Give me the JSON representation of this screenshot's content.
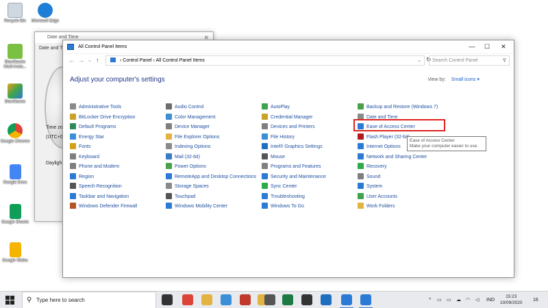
{
  "desktop": {
    "icons": [
      {
        "label": "Recycle Bin",
        "color": "#cfd8e0"
      },
      {
        "label": "Microsoft Edge",
        "color": "#1e7fd6"
      },
      {
        "label": "BlueStacks Multi-Insta...",
        "color": "#7ac143"
      },
      {
        "label": "BlueStacks",
        "color": "#e8a21a"
      },
      {
        "label": "Google Chrome",
        "color": "#db4437"
      },
      {
        "label": "Google Docs",
        "color": "#4285f4"
      },
      {
        "label": "Google Sheets",
        "color": "#0f9d58"
      },
      {
        "label": "Google Slides",
        "color": "#f4b400"
      }
    ]
  },
  "date_time_window": {
    "title": "Date and Time",
    "tab": "Date and Ti",
    "time_zone_label": "Time zo",
    "time_zone_value": "(UTC+07",
    "daylight_label": "Dayligh"
  },
  "control_panel": {
    "title": "All Control Panel Items",
    "address": {
      "crumb_1": "Control Panel",
      "crumb_2": "All Control Panel Items"
    },
    "search_placeholder": "Search Control Panel",
    "heading": "Adjust your computer's settings",
    "view_by_label": "View by:",
    "view_by_value": "Small icons",
    "columns": [
      [
        {
          "label": "Administrative Tools",
          "icon": "tools-icon",
          "color": "#8a8a8a"
        },
        {
          "label": "BitLocker Drive Encryption",
          "icon": "bitlocker-icon",
          "color": "#c9a227"
        },
        {
          "label": "Default Programs",
          "icon": "default-programs-icon",
          "color": "#2e8b57"
        },
        {
          "label": "Energy Star",
          "icon": "energy-star-icon",
          "color": "#3a8fd8"
        },
        {
          "label": "Fonts",
          "icon": "fonts-icon",
          "color": "#d4a017"
        },
        {
          "label": "Keyboard",
          "icon": "keyboard-icon",
          "color": "#7f7f7f"
        },
        {
          "label": "Phone and Modem",
          "icon": "phone-icon",
          "color": "#7f7f7f"
        },
        {
          "label": "Region",
          "icon": "region-icon",
          "color": "#2b7bd6"
        },
        {
          "label": "Speech Recognition",
          "icon": "microphone-icon",
          "color": "#555555"
        },
        {
          "label": "Taskbar and Navigation",
          "icon": "taskbar-icon",
          "color": "#2b7bd6"
        },
        {
          "label": "Windows Defender Firewall",
          "icon": "firewall-icon",
          "color": "#b5532a"
        }
      ],
      [
        {
          "label": "Audio Control",
          "icon": "audio-control-icon",
          "color": "#6d6d6d"
        },
        {
          "label": "Color Management",
          "icon": "color-management-icon",
          "color": "#3f8fd0"
        },
        {
          "label": "Device Manager",
          "icon": "device-manager-icon",
          "color": "#7f7f7f"
        },
        {
          "label": "File Explorer Options",
          "icon": "folder-options-icon",
          "color": "#e3b341"
        },
        {
          "label": "Indexing Options",
          "icon": "indexing-icon",
          "color": "#8a8a8a"
        },
        {
          "label": "Mail (32-bit)",
          "icon": "mail-icon",
          "color": "#3a7bc8"
        },
        {
          "label": "Power Options",
          "icon": "power-icon",
          "color": "#4aa14a"
        },
        {
          "label": "RemoteApp and Desktop Connections",
          "icon": "remoteapp-icon",
          "color": "#2b7bd6"
        },
        {
          "label": "Storage Spaces",
          "icon": "storage-icon",
          "color": "#8a8a8a"
        },
        {
          "label": "Touchpad",
          "icon": "touchpad-icon",
          "color": "#555555"
        },
        {
          "label": "Windows Mobility Center",
          "icon": "mobility-icon",
          "color": "#2b7bd6"
        }
      ],
      [
        {
          "label": "AutoPlay",
          "icon": "autoplay-icon",
          "color": "#3fa34d"
        },
        {
          "label": "Credential Manager",
          "icon": "credential-icon",
          "color": "#c9a227"
        },
        {
          "label": "Devices and Printers",
          "icon": "printer-icon",
          "color": "#7f7f7f"
        },
        {
          "label": "File History",
          "icon": "file-history-icon",
          "color": "#3a8fd8"
        },
        {
          "label": "Intel® Graphics Settings",
          "icon": "intel-icon",
          "color": "#1f6fc0"
        },
        {
          "label": "Mouse",
          "icon": "mouse-icon",
          "color": "#555555"
        },
        {
          "label": "Programs and Features",
          "icon": "programs-icon",
          "color": "#7f7f7f"
        },
        {
          "label": "Security and Maintenance",
          "icon": "security-flag-icon",
          "color": "#2b7bd6"
        },
        {
          "label": "Sync Center",
          "icon": "sync-icon",
          "color": "#2eaa4a"
        },
        {
          "label": "Troubleshooting",
          "icon": "troubleshoot-icon",
          "color": "#2b7bd6"
        },
        {
          "label": "Windows To Go",
          "icon": "windows-to-go-icon",
          "color": "#2b7bd6"
        }
      ],
      [
        {
          "label": "Backup and Restore (Windows 7)",
          "icon": "backup-icon",
          "color": "#4aa14a"
        },
        {
          "label": "Date and Time",
          "icon": "clock-icon",
          "color": "#8a8a8a"
        },
        {
          "label": "Ease of Access Center",
          "icon": "ease-of-access-icon",
          "color": "#2b7bd6"
        },
        {
          "label": "Flash Player (32-bit)",
          "icon": "flash-icon",
          "color": "#b3191e"
        },
        {
          "label": "Internet Options",
          "icon": "internet-options-icon",
          "color": "#2b7bd6"
        },
        {
          "label": "Network and Sharing Center",
          "icon": "network-icon",
          "color": "#2b7bd6"
        },
        {
          "label": "Recovery",
          "icon": "recovery-icon",
          "color": "#2eaa4a"
        },
        {
          "label": "Sound",
          "icon": "sound-icon",
          "color": "#7f7f7f"
        },
        {
          "label": "System",
          "icon": "system-icon",
          "color": "#2b7bd6"
        },
        {
          "label": "User Accounts",
          "icon": "user-accounts-icon",
          "color": "#3fa34d"
        },
        {
          "label": "Work Folders",
          "icon": "work-folders-icon",
          "color": "#e3b341"
        }
      ]
    ],
    "tooltip": {
      "title": "Ease of Access Center",
      "description": "Make your computer easier to use."
    }
  },
  "taskbar": {
    "search_placeholder": "Type here to search",
    "language": "IND",
    "time": "15:23",
    "date": "10/09/2020",
    "notification_count": "16",
    "apps": [
      {
        "name": "task-view-icon",
        "color": "#333333"
      },
      {
        "name": "chrome-icon",
        "color": "#db4437"
      },
      {
        "name": "file-explorer-icon",
        "color": "#e3b341"
      },
      {
        "name": "paint-icon",
        "color": "#3a8fd8"
      },
      {
        "name": "app-red-icon",
        "color": "#c0392b"
      },
      {
        "name": "app-yellow-icon",
        "color": "#e3b341"
      },
      {
        "name": "loading-app-icon",
        "color": "#555555"
      },
      {
        "name": "excel-icon",
        "color": "#1d7a45"
      },
      {
        "name": "settings-icon",
        "color": "#333333"
      },
      {
        "name": "photos-icon",
        "color": "#1f6fc0"
      },
      {
        "name": "date-time-app-icon",
        "color": "#2b7bd6"
      },
      {
        "name": "control-panel-app-icon",
        "color": "#2b7bd6"
      }
    ]
  }
}
